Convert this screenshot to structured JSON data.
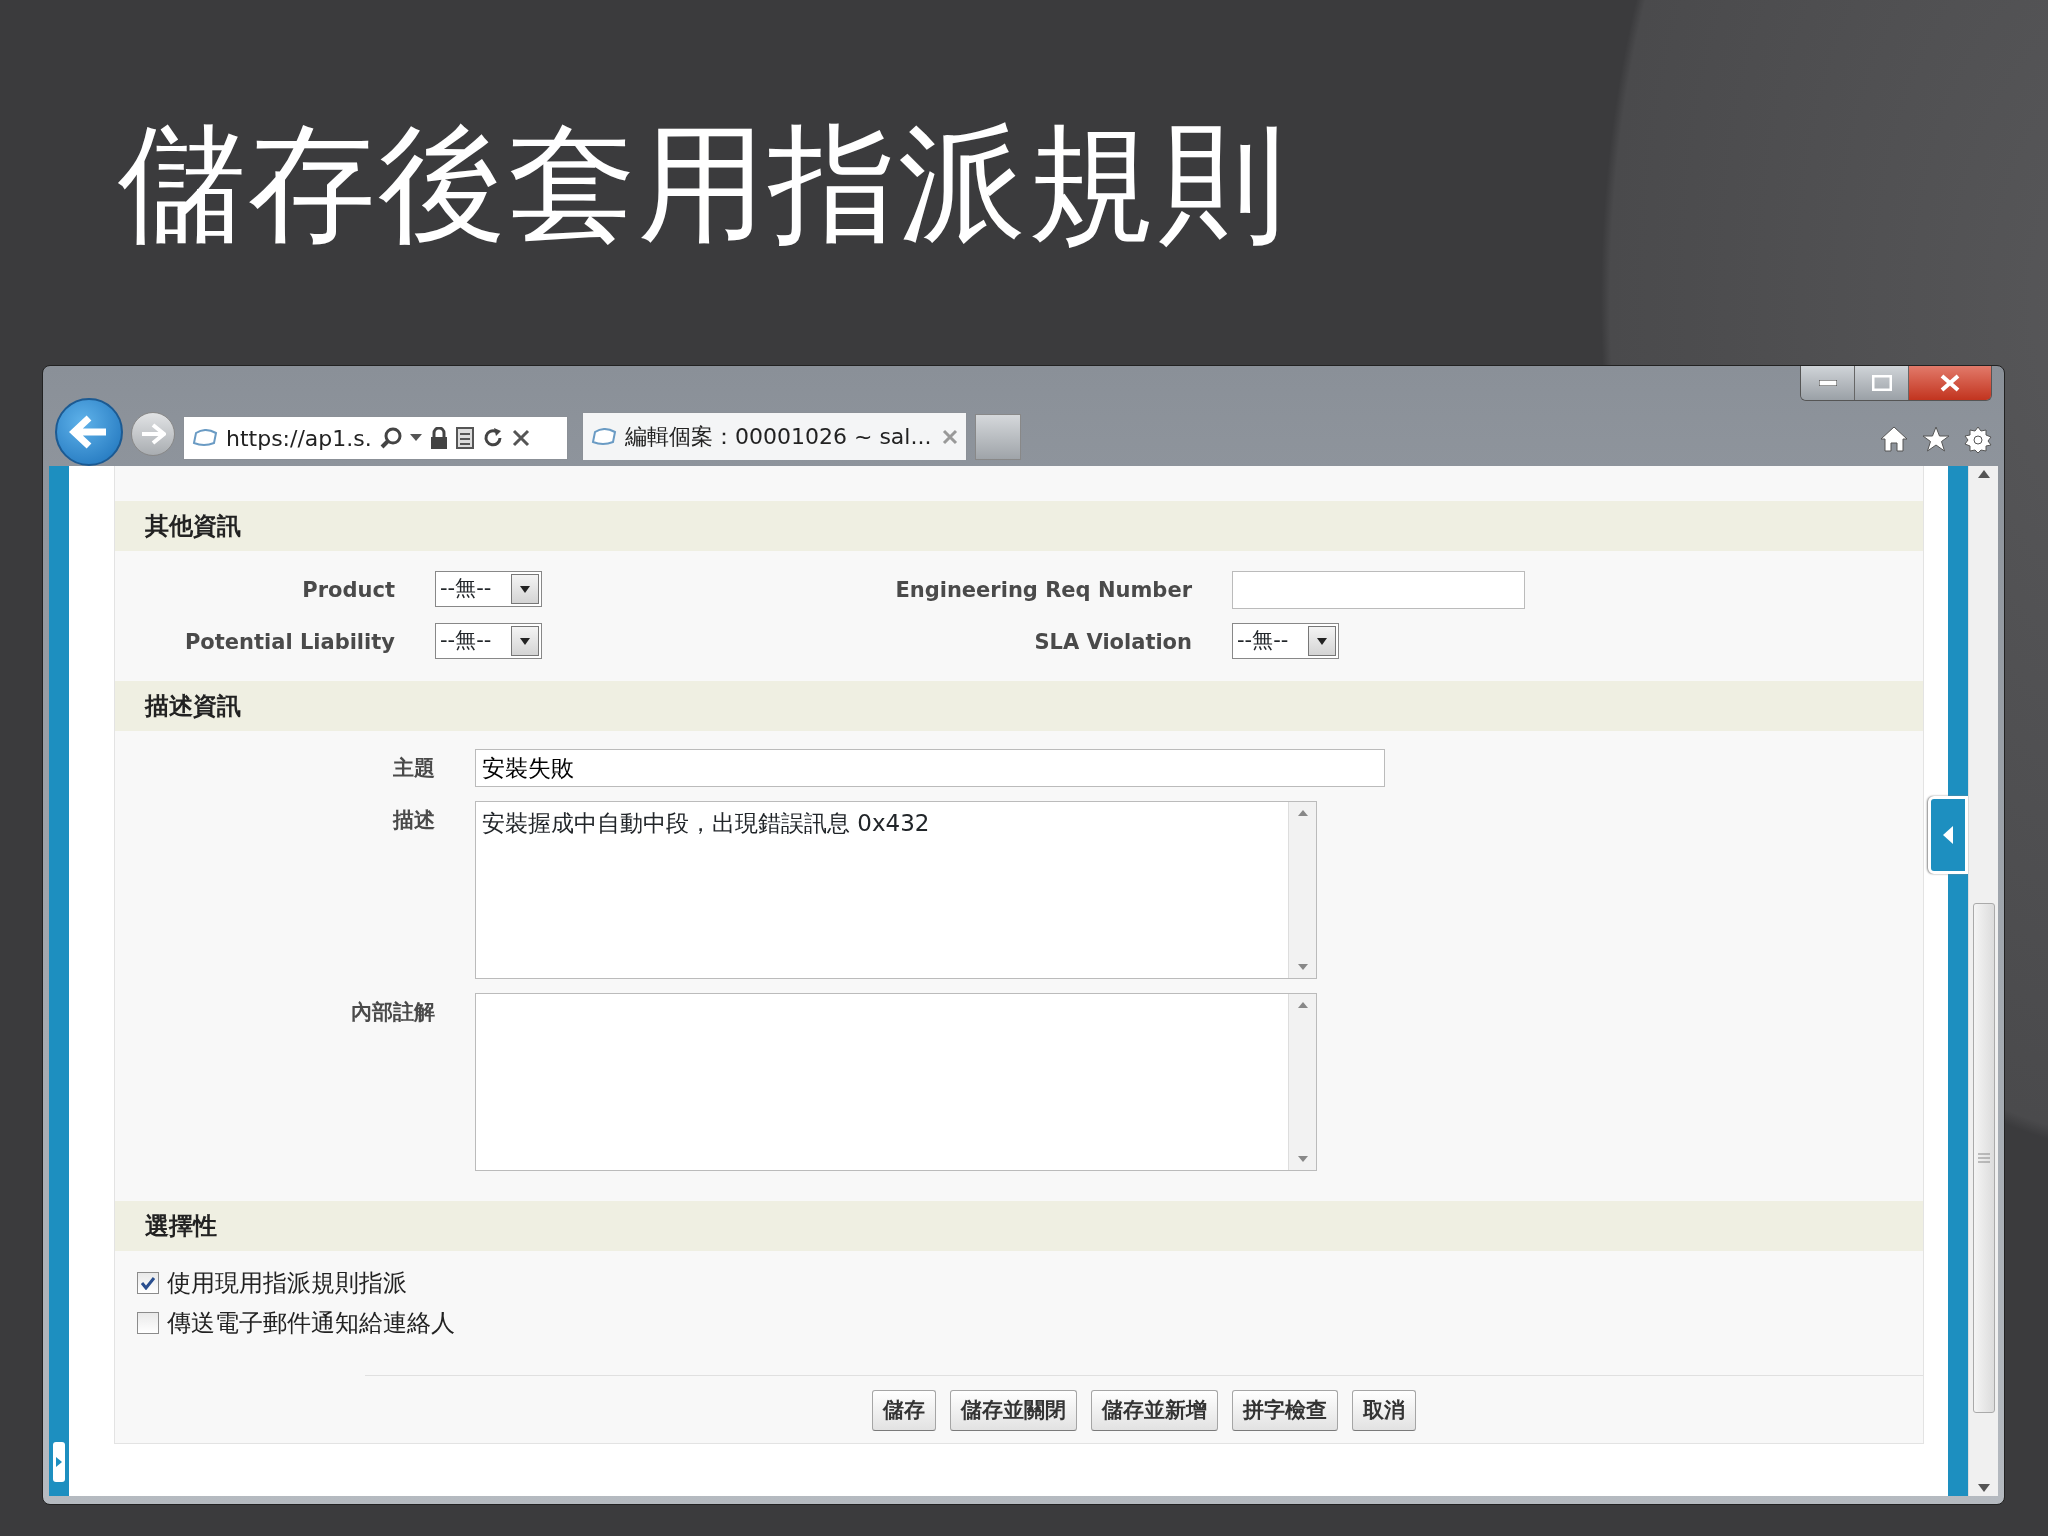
{
  "slide": {
    "title": "儲存後套用指派規則"
  },
  "browser": {
    "address": "https://ap1.s.",
    "tab_title": "編輯個案：00001026 ~ sal..."
  },
  "sections": [
    {
      "title": "其他資訊",
      "kind": "grid",
      "fields": [
        {
          "label": "Product",
          "kind": "select",
          "value": "--無--"
        },
        {
          "label": "Engineering Req Number",
          "kind": "text"
        },
        {
          "label": "Potential Liability",
          "kind": "select",
          "value": "--無--"
        },
        {
          "label": "SLA Violation",
          "kind": "select",
          "value": "--無--"
        }
      ]
    },
    {
      "title": "描述資訊",
      "kind": "stack",
      "fields": [
        {
          "label": "主題",
          "kind": "text",
          "value": "安裝失敗"
        },
        {
          "label": "描述",
          "kind": "textarea",
          "value": "安裝握成中自動中段，出現錯誤訊息 0x432"
        },
        {
          "label": "內部註解",
          "kind": "textarea"
        }
      ]
    },
    {
      "title": "選擇性",
      "kind": "checks",
      "options": [
        {
          "label": "使用現用指派規則指派",
          "checked": true
        },
        {
          "label": "傳送電子郵件通知給連絡人",
          "checked": false
        }
      ]
    }
  ],
  "buttons": [
    "儲存",
    "儲存並關閉",
    "儲存並新增",
    "拼字檢查",
    "取消"
  ]
}
